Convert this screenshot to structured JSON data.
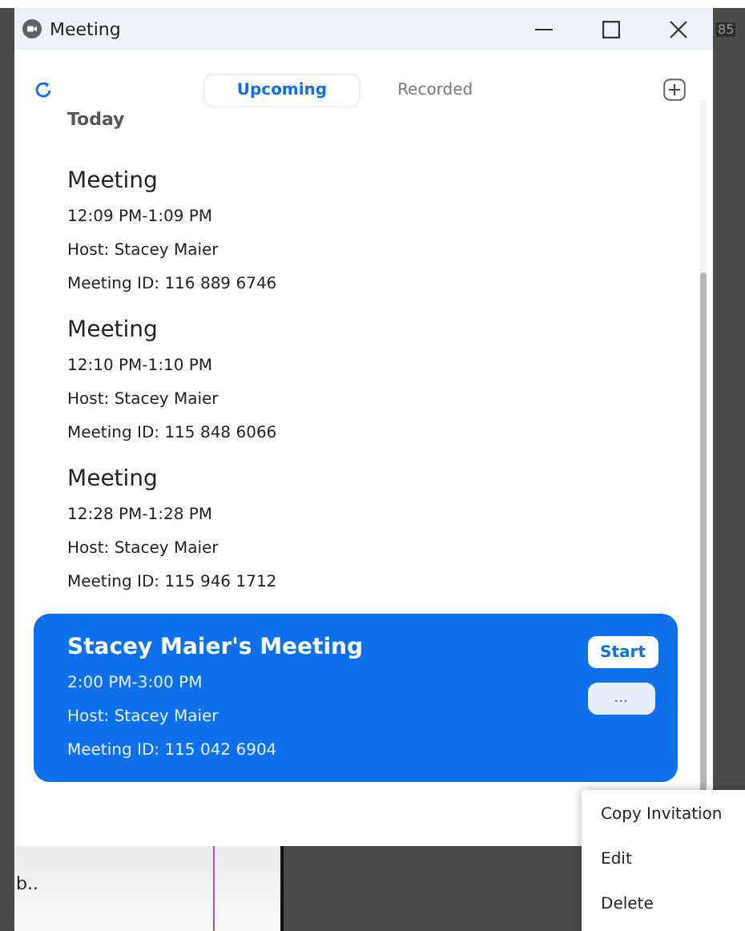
{
  "window": {
    "title": "Meeting"
  },
  "tabs": [
    {
      "label": "Upcoming",
      "selected": true
    },
    {
      "label": "Recorded",
      "selected": false
    }
  ],
  "section": "Today",
  "meetings": [
    {
      "title": "Meeting",
      "time": "12:09 PM-1:09 PM",
      "host": "Host: Stacey Maier",
      "meeting_id": "Meeting ID: 116 889 6746",
      "selected": false
    },
    {
      "title": "Meeting",
      "time": "12:10 PM-1:10 PM",
      "host": "Host: Stacey Maier",
      "meeting_id": "Meeting ID: 115 848 6066",
      "selected": false
    },
    {
      "title": "Meeting",
      "time": "12:28 PM-1:28 PM",
      "host": "Host: Stacey Maier",
      "meeting_id": "Meeting ID: 115 946 1712",
      "selected": false
    },
    {
      "title": "Stacey Maier's Meeting",
      "time": "2:00 PM-3:00 PM",
      "host": "Host: Stacey Maier",
      "meeting_id": "Meeting ID: 115 042 6904",
      "selected": true,
      "start_button": "Start",
      "more_button": "..."
    }
  ],
  "context_menu": [
    "Copy Invitation",
    "Edit",
    "Delete"
  ],
  "background": {
    "top_right_text": "85",
    "bottom_left_text": "b.."
  }
}
